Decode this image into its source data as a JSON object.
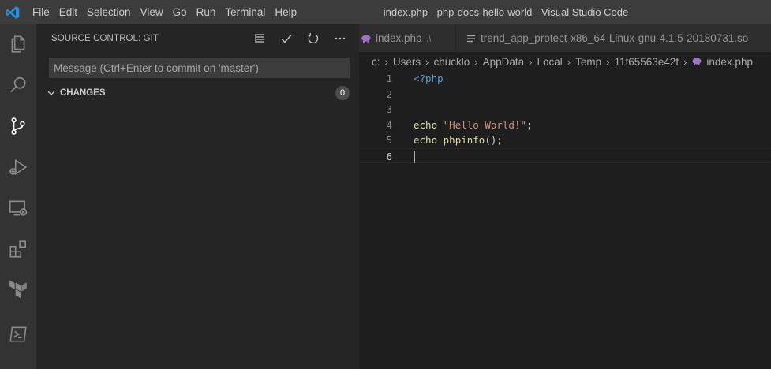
{
  "app": {
    "window_title": "index.php - php-docs-hello-world - Visual Studio Code",
    "logo_icon": "vscode-logo-icon",
    "accent_color": "#0078d4"
  },
  "menu": {
    "items": [
      "File",
      "Edit",
      "Selection",
      "View",
      "Go",
      "Run",
      "Terminal",
      "Help"
    ]
  },
  "activity_bar": {
    "items": [
      {
        "name": "explorer",
        "icon": "files-icon"
      },
      {
        "name": "search",
        "icon": "search-icon"
      },
      {
        "name": "source-control",
        "icon": "source-control-icon",
        "active": true
      },
      {
        "name": "run-debug",
        "icon": "run-debug-icon"
      },
      {
        "name": "remote-explorer",
        "icon": "remote-explorer-icon"
      },
      {
        "name": "extensions",
        "icon": "extensions-icon"
      },
      {
        "name": "terraform",
        "icon": "terraform-icon"
      },
      {
        "name": "powershell",
        "icon": "powershell-icon"
      }
    ]
  },
  "sidebar": {
    "title": "SOURCE CONTROL: GIT",
    "actions": [
      "view-as-list-icon",
      "commit-check-icon",
      "refresh-icon",
      "more-actions-icon"
    ],
    "commit_placeholder": "Message (Ctrl+Enter to commit on 'master')",
    "commit_value": "",
    "changes_label": "CHANGES",
    "changes_count": "0"
  },
  "tabs": [
    {
      "label": "index.php",
      "hint": ".\\",
      "icon": "php-elephant-icon"
    },
    {
      "label": "trend_app_protect-x86_64-Linux-gnu-4.1.5-20180731.so",
      "icon": "binary-file-icon"
    }
  ],
  "breadcrumb": {
    "segments": [
      "c:",
      "Users",
      "chucklo",
      "AppData",
      "Local",
      "Temp",
      "11f65563e42f"
    ],
    "file": "index.php"
  },
  "editor": {
    "lines": [
      {
        "n": "1",
        "parts": [
          {
            "t": "<?php",
            "c": "tok-tag"
          }
        ]
      },
      {
        "n": "2",
        "parts": []
      },
      {
        "n": "3",
        "parts": []
      },
      {
        "n": "4",
        "parts": [
          {
            "t": "echo",
            "c": "tok-kw"
          },
          {
            "t": " ",
            "c": ""
          },
          {
            "t": "\"Hello World!\"",
            "c": "tok-str"
          },
          {
            "t": ";",
            "c": ""
          }
        ]
      },
      {
        "n": "5",
        "parts": [
          {
            "t": "echo",
            "c": "tok-kw"
          },
          {
            "t": " ",
            "c": ""
          },
          {
            "t": "phpinfo",
            "c": "tok-fn"
          },
          {
            "t": "();",
            "c": ""
          }
        ]
      },
      {
        "n": "6",
        "parts": [],
        "current": true
      }
    ]
  }
}
